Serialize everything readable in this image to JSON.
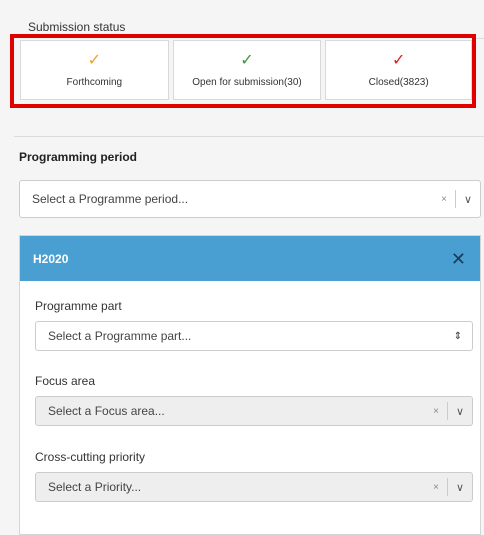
{
  "submission_status": {
    "heading": "Submission status",
    "cards": [
      {
        "label": "Forthcoming",
        "check": "✓",
        "color": "#f0a030"
      },
      {
        "label": "Open for submission(30)",
        "check": "✓",
        "color": "#3a9a3a"
      },
      {
        "label": "Closed(3823)",
        "check": "✓",
        "color": "#e01c1c"
      }
    ]
  },
  "programming_period": {
    "heading": "Programming period",
    "placeholder": "Select a Programme period..."
  },
  "panel": {
    "title": "H2020",
    "close": "✕",
    "accent": "#4a9fd2",
    "programme_part": {
      "label": "Programme part",
      "placeholder": "Select a Programme part..."
    },
    "focus_area": {
      "label": "Focus area",
      "placeholder": "Select a Focus area..."
    },
    "cross_cutting_priority": {
      "label": "Cross-cutting priority",
      "placeholder": "Select a Priority..."
    }
  },
  "icons": {
    "clear": "×",
    "chevron": "∨",
    "sort": "⇕"
  },
  "highlight_color": "#e00000"
}
